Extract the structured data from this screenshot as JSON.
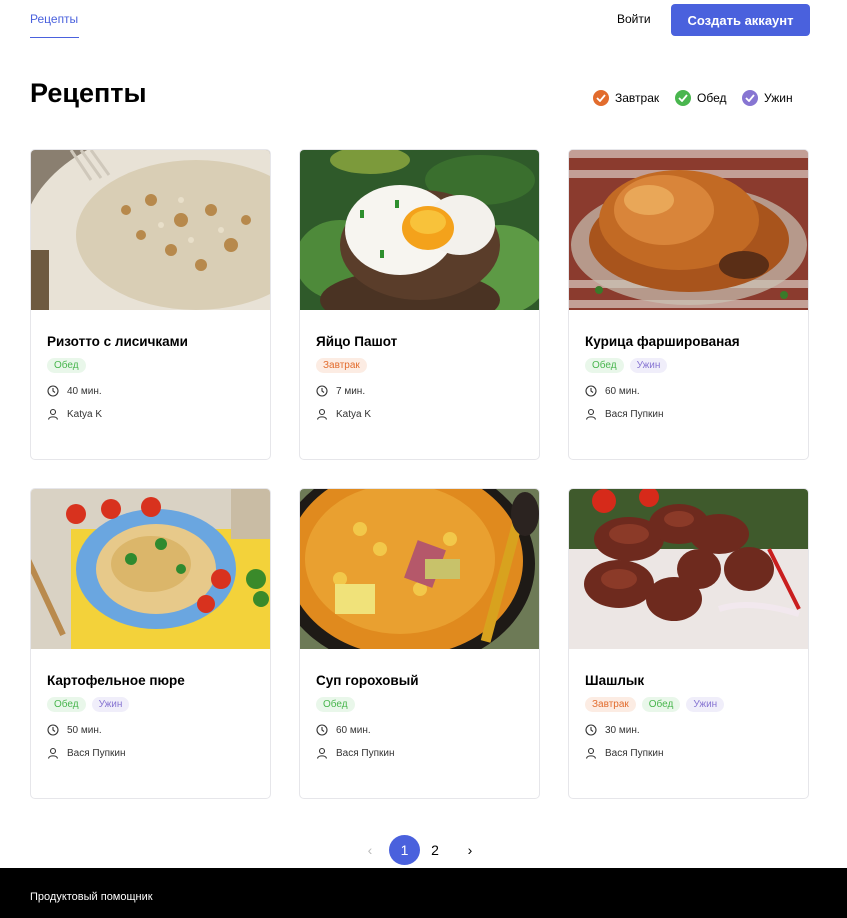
{
  "header": {
    "nav_recipes": "Рецепты",
    "login": "Войти",
    "create_account": "Создать аккаунт"
  },
  "page": {
    "title": "Рецепты",
    "filters": [
      {
        "label": "Завтрак",
        "color": "#e26c2d",
        "checked": true
      },
      {
        "label": "Обед",
        "color": "#49b64e",
        "checked": true
      },
      {
        "label": "Ужин",
        "color": "#8775d2",
        "checked": true
      }
    ]
  },
  "recipes": [
    {
      "title": "Ризотто с лисичками",
      "tags": [
        "Обед"
      ],
      "time": "40 мин.",
      "author": "Katya K",
      "image": "risotto"
    },
    {
      "title": "Яйцо Пашот",
      "tags": [
        "Завтрак"
      ],
      "time": "7 мин.",
      "author": "Katya K",
      "image": "poached-egg"
    },
    {
      "title": "Курица фаршированая",
      "tags": [
        "Обед",
        "Ужин"
      ],
      "time": "60 мин.",
      "author": "Вася Пупкин",
      "image": "roast-chicken"
    },
    {
      "title": "Картофельное пюре",
      "tags": [
        "Обед",
        "Ужин"
      ],
      "time": "50 мин.",
      "author": "Вася Пупкин",
      "image": "mashed-potato"
    },
    {
      "title": "Суп гороховый",
      "tags": [
        "Обед"
      ],
      "time": "60 мин.",
      "author": "Вася Пупкин",
      "image": "pea-soup"
    },
    {
      "title": "Шашлык",
      "tags": [
        "Завтрак",
        "Обед",
        "Ужин"
      ],
      "time": "30 мин.",
      "author": "Вася Пупкин",
      "image": "shashlik"
    }
  ],
  "pagination": {
    "prev": "‹",
    "current": "1",
    "page2": "2",
    "next": "›"
  },
  "footer": {
    "brand": "Продуктовый помощник"
  }
}
